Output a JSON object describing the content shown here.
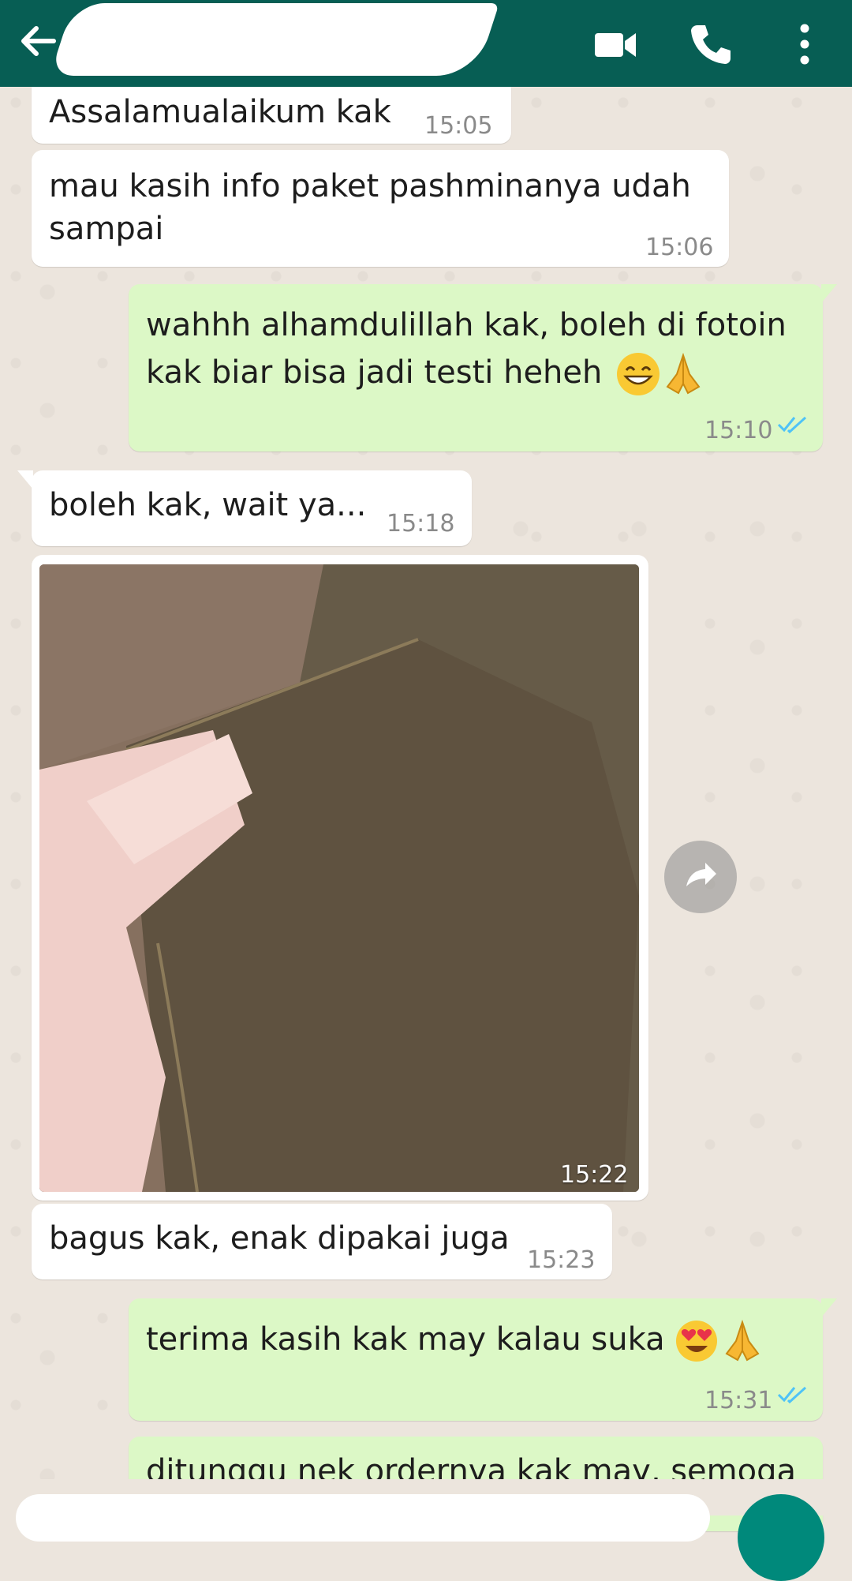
{
  "header": {
    "contact_name": "",
    "icons": [
      "back-arrow-icon",
      "video-call-icon",
      "phone-icon",
      "more-vert-icon"
    ],
    "color": "#075E54"
  },
  "messages": [
    {
      "dir": "in",
      "text": "Assalamualaikum kak",
      "time": "15:05"
    },
    {
      "dir": "in",
      "text_line1": "mau kasih info paket pashminanya udah",
      "text_line2": "sampai",
      "time": "15:06"
    },
    {
      "dir": "out",
      "text_line1": "wahhh alhamdulillah kak, boleh di fotoin",
      "text_line2": "kak biar bisa jadi testi heheh",
      "emoji": [
        "grin-icon",
        "folded-hands-icon"
      ],
      "time": "15:10",
      "status": "read"
    },
    {
      "dir": "in",
      "text": "boleh kak, wait ya...",
      "time": "15:18"
    },
    {
      "dir": "in",
      "type": "image",
      "time": "15:22"
    },
    {
      "dir": "in",
      "text": "bagus kak, enak dipakai juga",
      "time": "15:23"
    },
    {
      "dir": "out",
      "text": "terima kasih kak may kalau suka",
      "emoji": [
        "heart-eyes-icon",
        "folded-hands-icon"
      ],
      "time": "15:31",
      "status": "read"
    },
    {
      "dir": "out",
      "text": "ditunggu nek ordernya kak may, semoga"
    }
  ],
  "colors": {
    "incoming": "#FFFFFF",
    "outgoing": "#DCF8C6",
    "read_ticks": "#4FC3F7",
    "wallpaper": "#ECE5DD"
  }
}
